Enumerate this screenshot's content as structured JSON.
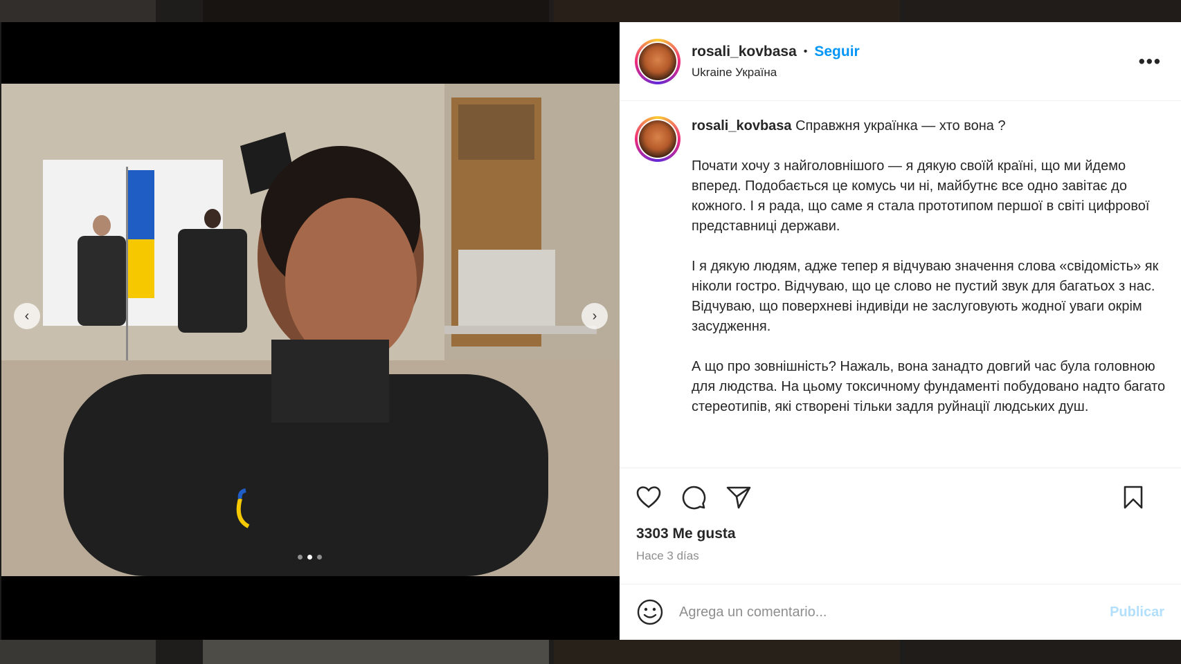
{
  "post": {
    "username": "rosali_kovbasa",
    "separator": "•",
    "follow_label": "Seguir",
    "location": "Ukraine Україна",
    "more_icon": "more-options-icon",
    "caption": {
      "username": "rosali_kovbasa",
      "first_line": "Справжня українка — хто вона ?",
      "paragraphs": [
        "Почати хочу з найголовнішого — я дякую своїй країні, що ми йдемо вперед. Подобається це комусь чи ні, майбутнє все одно завітає до кожного. І я рада, що саме я стала прототипом першої в світі цифрової представниці держави.",
        "І я дякую людям, адже тепер я відчуваю значення слова «свідомість» як ніколи гостро. Відчуваю, що це слово не пустий звук для багатьох з нас. Відчуваю, що поверхневі індивіди не заслуговують жодної уваги окрім засудження.",
        "А що про зовнішність? Нажаль, вона занадто довгий час була головною для людства. На цьому токсичному фундаменті побудовано надто багато стереотипів, які створені тільки задля руйнації людських душ."
      ]
    },
    "likes": "3303 Me gusta",
    "time": "Hace 3 días",
    "comment": {
      "placeholder": "Agrega un comentario...",
      "publish_label": "Publicar"
    },
    "carousel": {
      "slides": 3,
      "active_index": 1
    }
  },
  "colors": {
    "follow": "#0095f6",
    "publish_disabled": "#b2dffc"
  }
}
